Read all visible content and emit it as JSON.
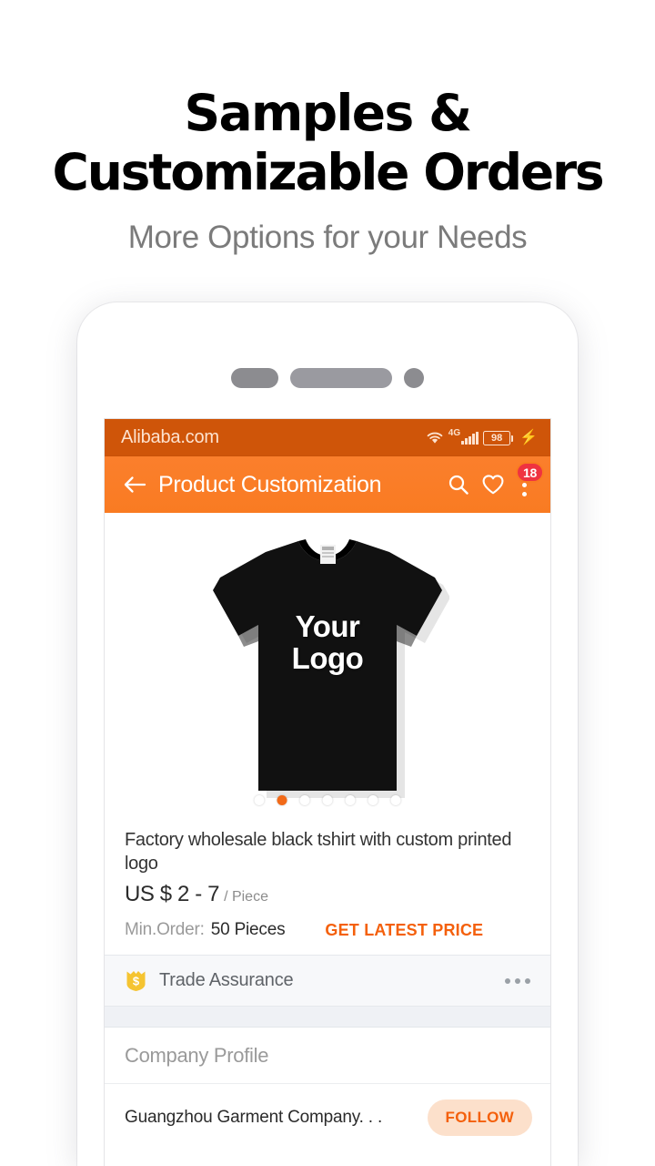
{
  "promo": {
    "title_line1": "Samples &",
    "title_line2": "Customizable Orders",
    "subtitle": "More Options for your Needs"
  },
  "colors": {
    "status_bar": "#cf5509",
    "app_bar": "#f97b22",
    "accent_orange": "#f4600c",
    "badge_red": "#ef3340",
    "trade_assurance_gold": "#f5c431",
    "follow_pill": "#fce0cb",
    "spacer_band": "#eff1f5"
  },
  "status_bar": {
    "brand": "Alibaba.com",
    "wifi_icon": "wifi-icon",
    "network_label": "4G",
    "signal_icon": "signal-bars-icon",
    "battery_level": "98",
    "charging_icon": "lightning-bolt-icon"
  },
  "app_bar": {
    "back_icon": "back-arrow-icon",
    "title": "Product Customization",
    "search_icon": "search-icon",
    "favorite_icon": "heart-icon",
    "overflow_icon": "overflow-menu-icon",
    "notification_count": "18"
  },
  "gallery": {
    "product_image": "black-tshirt-image",
    "logo_line1": "Your",
    "logo_line2": "Logo",
    "dot_count": 7,
    "active_dot_index": 1
  },
  "product": {
    "title": "Factory wholesale black tshirt with custom printed logo",
    "price": "US $ 2 - 7",
    "price_unit": "/ Piece",
    "min_order_label": "Min.Order:",
    "min_order_value": "50 Pieces",
    "get_latest_price": "GET LATEST PRICE"
  },
  "trade_assurance": {
    "icon": "trade-assurance-shield-icon",
    "label": "Trade Assurance",
    "more_icon": "more-dots-icon"
  },
  "company_profile": {
    "header": "Company Profile",
    "name": "Guangzhou Garment Company. . .",
    "follow_label": "FOLLOW"
  }
}
